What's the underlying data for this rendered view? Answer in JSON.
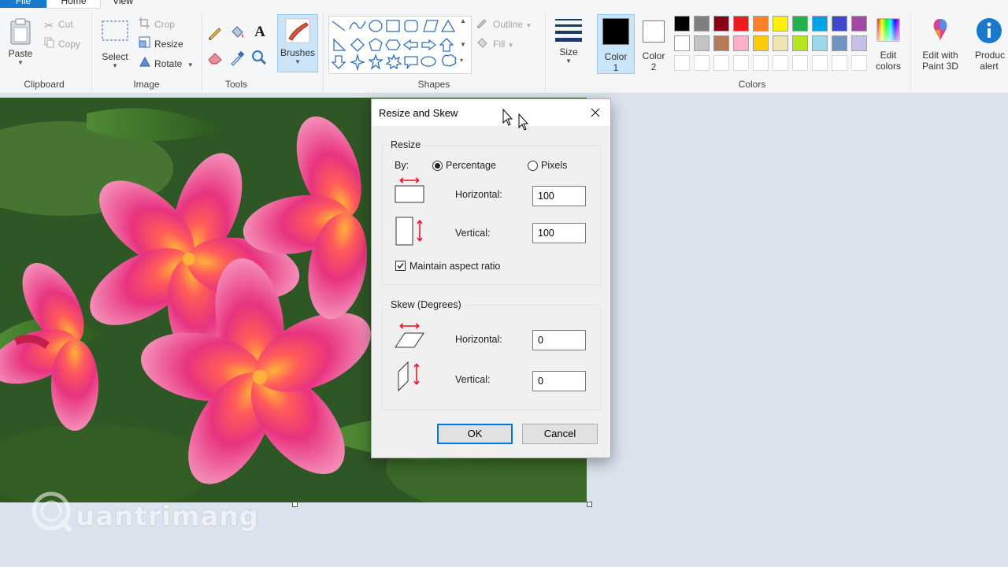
{
  "ribbon": {
    "tabs": {
      "file": "File",
      "home": "Home",
      "view": "View"
    },
    "clipboard": {
      "paste": "Paste",
      "cut": "Cut",
      "copy": "Copy",
      "label": "Clipboard"
    },
    "image": {
      "select": "Select",
      "crop": "Crop",
      "resize": "Resize",
      "rotate": "Rotate",
      "label": "Image"
    },
    "tools": {
      "label": "Tools"
    },
    "brushes": "Brushes",
    "shapes": {
      "outline": "Outline",
      "fill": "Fill",
      "label": "Shapes"
    },
    "size": "Size",
    "color1": {
      "line1": "Color",
      "line2": "1"
    },
    "color2": {
      "line1": "Color",
      "line2": "2"
    },
    "edit_colors": {
      "line1": "Edit",
      "line2": "colors"
    },
    "edit_paint3d": {
      "line1": "Edit with",
      "line2": "Paint 3D"
    },
    "product_alert": {
      "line1": "Produc",
      "line2": "alert"
    },
    "colors_label": "Colors",
    "palette_row1": [
      "#000000",
      "#7f7f7f",
      "#880015",
      "#ed1c24",
      "#ff7f27",
      "#fff200",
      "#22b14c",
      "#00a2e8",
      "#3f48cc",
      "#a349a4"
    ],
    "palette_row2": [
      "#ffffff",
      "#c3c3c3",
      "#b97a57",
      "#ffaec9",
      "#ffc90e",
      "#efe4b0",
      "#b5e61d",
      "#99d9ea",
      "#7092be",
      "#c8bfe7"
    ]
  },
  "watermark": {
    "text": "uantrimang"
  },
  "dialog": {
    "title": "Resize and Skew",
    "resize": {
      "legend": "Resize",
      "by_label": "By:",
      "percentage_label": "Percentage",
      "pixels_label": "Pixels",
      "selected_unit": "Percentage",
      "horizontal_label": "Horizontal:",
      "horizontal_value": "100",
      "vertical_label": "Vertical:",
      "vertical_value": "100",
      "maintain_aspect_label": "Maintain aspect ratio",
      "maintain_aspect_checked": true
    },
    "skew": {
      "legend": "Skew (Degrees)",
      "horizontal_label": "Horizontal:",
      "horizontal_value": "0",
      "vertical_label": "Vertical:",
      "vertical_value": "0"
    },
    "ok": "OK",
    "cancel": "Cancel"
  },
  "colors": {
    "accent": "#1979ca",
    "dialog_border": "#8fb4dc",
    "focus": "#0078d7",
    "arrow_red": "#e81123"
  }
}
